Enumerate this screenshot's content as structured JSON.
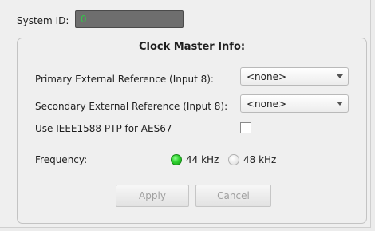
{
  "system_id": {
    "label": "System ID:",
    "value": "0"
  },
  "group": {
    "title": "Clock Master Info:"
  },
  "primary_ref": {
    "label": "Primary External Reference (Input 8):",
    "selected": "<none>"
  },
  "secondary_ref": {
    "label": "Secondary External Reference (Input 8):",
    "selected": "<none>"
  },
  "ptp": {
    "label": "Use IEEE1588 PTP for AES67",
    "checked": false
  },
  "frequency": {
    "label": "Frequency:",
    "options": [
      {
        "label": "44 kHz",
        "selected": true
      },
      {
        "label": "48 kHz",
        "selected": false
      }
    ]
  },
  "buttons": {
    "apply": "Apply",
    "cancel": "Cancel"
  },
  "colors": {
    "radio_on": "#2fd12f",
    "system_id_text": "#35c24a",
    "disabled_text": "#a0a0a0"
  }
}
